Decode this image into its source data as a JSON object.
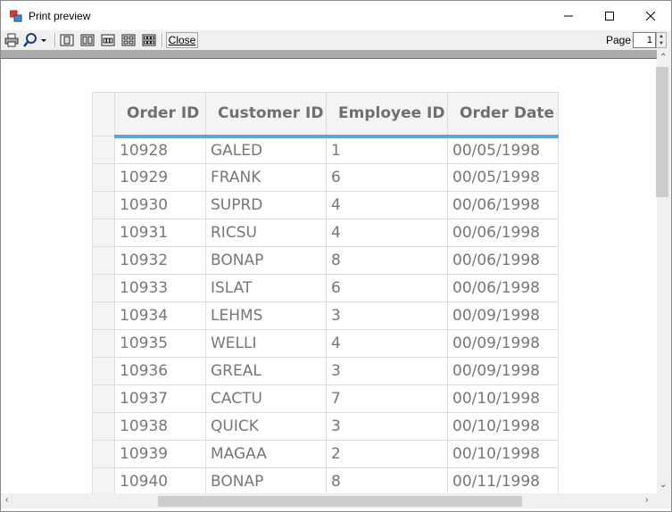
{
  "window": {
    "title": "Print preview",
    "minimize_icon": "minimize-icon",
    "maximize_icon": "maximize-icon",
    "close_icon": "close-icon"
  },
  "toolbar": {
    "icons": [
      "print-icon",
      "zoom-icon",
      "single-page-icon",
      "two-pages-icon",
      "three-pages-icon",
      "four-pages-icon",
      "six-pages-icon"
    ],
    "close_label": "Close",
    "page_label": "Page",
    "page_value": "1"
  },
  "grid": {
    "columns": [
      "Order ID",
      "Customer ID",
      "Employee ID",
      "Order Date"
    ],
    "rows": [
      [
        "10928",
        "GALED",
        "1",
        "00/05/1998"
      ],
      [
        "10929",
        "FRANK",
        "6",
        "00/05/1998"
      ],
      [
        "10930",
        "SUPRD",
        "4",
        "00/06/1998"
      ],
      [
        "10931",
        "RICSU",
        "4",
        "00/06/1998"
      ],
      [
        "10932",
        "BONAP",
        "8",
        "00/06/1998"
      ],
      [
        "10933",
        "ISLAT",
        "6",
        "00/06/1998"
      ],
      [
        "10934",
        "LEHMS",
        "3",
        "00/09/1998"
      ],
      [
        "10935",
        "WELLI",
        "4",
        "00/09/1998"
      ],
      [
        "10936",
        "GREAL",
        "3",
        "00/09/1998"
      ],
      [
        "10937",
        "CACTU",
        "7",
        "00/10/1998"
      ],
      [
        "10938",
        "QUICK",
        "3",
        "00/10/1998"
      ],
      [
        "10939",
        "MAGAA",
        "2",
        "00/10/1998"
      ],
      [
        "10940",
        "BONAP",
        "8",
        "00/11/1998"
      ]
    ]
  },
  "colors": {
    "header_accent": "#5ea6d6",
    "cell_text": "#777777",
    "header_text": "#6f6f6f"
  }
}
